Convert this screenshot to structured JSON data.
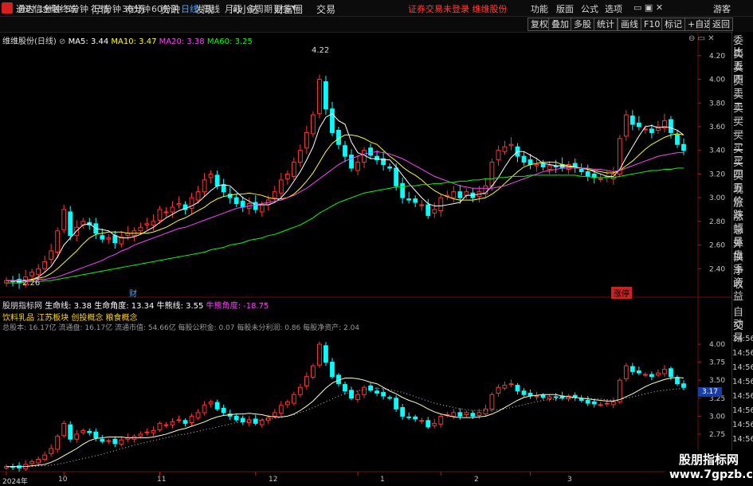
{
  "titlebar": {
    "app_title": "通达信金融终端",
    "menus": [
      "行情",
      "市场",
      "资讯",
      "发现",
      "问小达",
      "财富圈",
      "交易"
    ],
    "login_status": "证券交易未登录",
    "stock_name": "维维股份",
    "right_menus": [
      "功能",
      "版面",
      "公式",
      "选项"
    ],
    "guest": "游客"
  },
  "periods": [
    "分时",
    "1分钟",
    "5分钟",
    "15分钟",
    "30分钟",
    "60分钟",
    "日线",
    "周线",
    "月线",
    "多周期",
    "更多"
  ],
  "active_period": "日线",
  "toolbar_buttons": [
    "复权",
    "叠加",
    "多股",
    "统计",
    "画线",
    "F10",
    "标记",
    "+自选",
    "返回"
  ],
  "main_legend": {
    "name": "维维股份(日线)",
    "ma5": "MA5: 3.44",
    "ma10": "MA10: 3.47",
    "ma20": "MA20: 3.38",
    "ma60": "MA60: 3.25",
    "colors": {
      "ma5": "#ffffff",
      "ma10": "#ffff00",
      "ma20": "#ff40ff",
      "ma60": "#00ff00"
    }
  },
  "annotations": {
    "high": "4.22",
    "low": "2.26",
    "cai": "财",
    "zhangting": "涨停"
  },
  "sub_legend": {
    "name": "股朋指标网",
    "life_line": "生命线: 3.38",
    "life_angle": "生命角度: 13.34",
    "bull_line": "牛熊线: 3.55",
    "bull_angle": "牛熊角度: -18.75"
  },
  "info": {
    "concepts": "饮料乳品 江苏板块 创投概念 粮食概念",
    "fundamentals": "总股本: 16.17亿 流通盘: 16.17亿 流通市值: 54.66亿 每股公积金: 0.07 每股未分利润: 0.86 每股净资产: 2.04"
  },
  "side_panel": [
    "委比",
    "卖五",
    "卖四",
    "卖三",
    "卖二",
    "卖一",
    "买一",
    "买二",
    "买三",
    "买四",
    "买五",
    "现价",
    "涨跌",
    "涨幅",
    "总量",
    "外盘",
    "换手",
    "净资",
    "收益",
    "自动",
    "交易"
  ],
  "side_times": [
    "14:56",
    "14:56",
    "14:56",
    "14:56",
    "14:56",
    "14:56",
    "14:56",
    "14:56"
  ],
  "current_price": "3.17",
  "x_labels": [
    "2024年",
    "10",
    "11",
    "12",
    "1",
    "2",
    "3"
  ],
  "watermark": {
    "line1": "股朋指标网",
    "line2": "www.7gpzb.com"
  },
  "chart_data": [
    {
      "type": "candlestick",
      "ylim": [
        2.2,
        4.3
      ],
      "y_ticks": [
        "4.20",
        "4.00",
        "3.80",
        "3.60",
        "3.40",
        "3.20",
        "3.00",
        "2.80",
        "2.60",
        "2.40"
      ],
      "close": [
        2.3,
        2.29,
        2.28,
        2.33,
        2.37,
        2.4,
        2.46,
        2.55,
        2.72,
        2.9,
        2.68,
        2.75,
        2.8,
        2.77,
        2.7,
        2.65,
        2.66,
        2.62,
        2.67,
        2.7,
        2.72,
        2.75,
        2.78,
        2.8,
        2.9,
        2.88,
        2.92,
        2.95,
        2.9,
        3.0,
        3.05,
        3.15,
        3.2,
        3.1,
        3.05,
        3.0,
        2.95,
        2.92,
        2.95,
        2.9,
        2.94,
        2.98,
        3.05,
        3.15,
        3.2,
        3.3,
        3.4,
        3.55,
        3.7,
        4.0,
        3.75,
        3.55,
        3.45,
        3.35,
        3.25,
        3.3,
        3.4,
        3.36,
        3.32,
        3.28,
        3.25,
        3.1,
        3.0,
        2.98,
        2.96,
        2.94,
        2.85,
        2.9,
        3.0,
        3.02,
        3.05,
        3.0,
        3.05,
        3.0,
        3.05,
        3.1,
        3.3,
        3.4,
        3.43,
        3.45,
        3.35,
        3.3,
        3.28,
        3.28,
        3.26,
        3.27,
        3.26,
        3.25,
        3.28,
        3.26,
        3.22,
        3.18,
        3.17,
        3.16,
        3.18,
        3.2,
        3.5,
        3.7,
        3.62,
        3.6,
        3.58,
        3.55,
        3.6,
        3.65,
        3.55,
        3.45,
        3.4
      ],
      "ma5": [
        2.3,
        2.3,
        2.29,
        2.3,
        2.31,
        2.33,
        2.37,
        2.42,
        2.5,
        2.6,
        2.66,
        2.72,
        2.77,
        2.78,
        2.74,
        2.73,
        2.72,
        2.68,
        2.66,
        2.66,
        2.67,
        2.69,
        2.72,
        2.75,
        2.79,
        2.83,
        2.86,
        2.89,
        2.91,
        2.93,
        2.96,
        3.01,
        3.06,
        3.1,
        3.11,
        3.1,
        3.05,
        3.0,
        2.97,
        2.94,
        2.94,
        2.94,
        2.96,
        3.0,
        3.06,
        3.14,
        3.22,
        3.32,
        3.43,
        3.59,
        3.68,
        3.71,
        3.65,
        3.62,
        3.47,
        3.38,
        3.36,
        3.33,
        3.33,
        3.32,
        3.32,
        3.26,
        3.19,
        3.12,
        3.06,
        3.0,
        2.95,
        2.93,
        2.93,
        2.94,
        2.95,
        2.96,
        3.02,
        3.02,
        3.03,
        3.04,
        3.1,
        3.17,
        3.26,
        3.34,
        3.39,
        3.39,
        3.36,
        3.33,
        3.29,
        3.28,
        3.27,
        3.27,
        3.26,
        3.26,
        3.25,
        3.24,
        3.22,
        3.2,
        3.18,
        3.18,
        3.24,
        3.34,
        3.43,
        3.52,
        3.6,
        3.61,
        3.59,
        3.6,
        3.59,
        3.57,
        3.53
      ],
      "ma10": [
        2.3,
        2.3,
        2.3,
        2.3,
        2.31,
        2.32,
        2.33,
        2.36,
        2.4,
        2.45,
        2.5,
        2.55,
        2.61,
        2.66,
        2.69,
        2.7,
        2.71,
        2.71,
        2.71,
        2.7,
        2.7,
        2.7,
        2.7,
        2.71,
        2.73,
        2.75,
        2.78,
        2.81,
        2.83,
        2.86,
        2.89,
        2.92,
        2.96,
        2.99,
        3.01,
        3.02,
        3.03,
        3.03,
        3.04,
        3.03,
        3.02,
        3.0,
        2.99,
        2.99,
        3.0,
        3.03,
        3.08,
        3.14,
        3.21,
        3.3,
        3.39,
        3.46,
        3.5,
        3.53,
        3.53,
        3.52,
        3.5,
        3.47,
        3.45,
        3.4,
        3.35,
        3.31,
        3.26,
        3.22,
        3.19,
        3.15,
        3.1,
        3.06,
        3.03,
        3.01,
        2.99,
        2.98,
        2.98,
        2.98,
        2.99,
        3.0,
        3.03,
        3.07,
        3.12,
        3.17,
        3.22,
        3.26,
        3.28,
        3.29,
        3.3,
        3.3,
        3.3,
        3.28,
        3.27,
        3.26,
        3.25,
        3.24,
        3.23,
        3.22,
        3.21,
        3.21,
        3.23,
        3.27,
        3.31,
        3.36,
        3.41,
        3.45,
        3.48,
        3.51,
        3.53,
        3.54,
        3.53
      ],
      "ma20": [
        2.3,
        2.3,
        2.3,
        2.3,
        2.3,
        2.31,
        2.31,
        2.32,
        2.33,
        2.35,
        2.37,
        2.39,
        2.41,
        2.43,
        2.45,
        2.47,
        2.5,
        2.52,
        2.55,
        2.57,
        2.6,
        2.62,
        2.64,
        2.66,
        2.68,
        2.7,
        2.72,
        2.74,
        2.75,
        2.77,
        2.79,
        2.81,
        2.83,
        2.85,
        2.87,
        2.89,
        2.91,
        2.92,
        2.93,
        2.94,
        2.95,
        2.96,
        2.97,
        2.98,
        3.0,
        3.02,
        3.05,
        3.08,
        3.12,
        3.16,
        3.2,
        3.24,
        3.28,
        3.31,
        3.33,
        3.35,
        3.37,
        3.38,
        3.39,
        3.38,
        3.37,
        3.35,
        3.33,
        3.3,
        3.27,
        3.24,
        3.21,
        3.18,
        3.16,
        3.14,
        3.12,
        3.1,
        3.09,
        3.08,
        3.08,
        3.08,
        3.08,
        3.09,
        3.1,
        3.12,
        3.14,
        3.16,
        3.18,
        3.2,
        3.22,
        3.23,
        3.24,
        3.25,
        3.25,
        3.25,
        3.25,
        3.25,
        3.24,
        3.24,
        3.23,
        3.22,
        3.23,
        3.25,
        3.27,
        3.29,
        3.31,
        3.33,
        3.35,
        3.36,
        3.37,
        3.38,
        3.38
      ],
      "ma60": [
        2.28,
        2.28,
        2.28,
        2.29,
        2.29,
        2.29,
        2.3,
        2.3,
        2.31,
        2.32,
        2.33,
        2.34,
        2.35,
        2.36,
        2.37,
        2.38,
        2.39,
        2.4,
        2.41,
        2.42,
        2.43,
        2.44,
        2.45,
        2.46,
        2.47,
        2.48,
        2.49,
        2.5,
        2.51,
        2.52,
        2.53,
        2.54,
        2.56,
        2.57,
        2.58,
        2.6,
        2.61,
        2.62,
        2.64,
        2.65,
        2.66,
        2.68,
        2.69,
        2.71,
        2.73,
        2.75,
        2.77,
        2.8,
        2.83,
        2.87,
        2.9,
        2.93,
        2.96,
        2.98,
        3.0,
        3.02,
        3.04,
        3.05,
        3.06,
        3.07,
        3.08,
        3.09,
        3.09,
        3.1,
        3.1,
        3.11,
        3.11,
        3.12,
        3.12,
        3.13,
        3.13,
        3.14,
        3.14,
        3.15,
        3.15,
        3.16,
        3.16,
        3.17,
        3.17,
        3.18,
        3.18,
        3.18,
        3.19,
        3.19,
        3.19,
        3.19,
        3.19,
        3.19,
        3.19,
        3.19,
        3.18,
        3.18,
        3.17,
        3.17,
        3.17,
        3.17,
        3.18,
        3.19,
        3.2,
        3.21,
        3.22,
        3.23,
        3.23,
        3.24,
        3.24,
        3.25,
        3.25
      ]
    },
    {
      "type": "line",
      "ylim": [
        2.55,
        4.1
      ],
      "y_ticks": [
        "4.00",
        "3.75",
        "3.50",
        "3.25",
        "3.00",
        "2.75"
      ]
    }
  ]
}
